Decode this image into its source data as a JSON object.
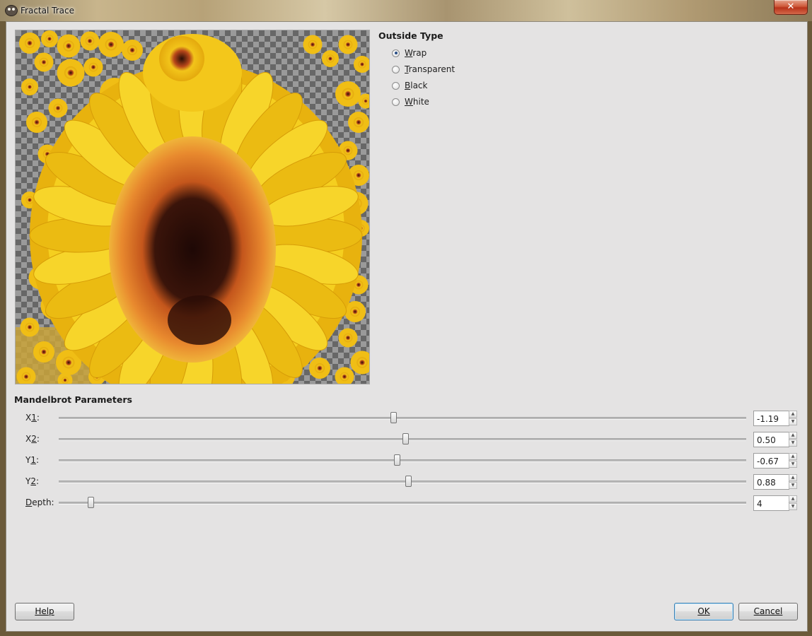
{
  "window": {
    "title": "Fractal Trace",
    "close_label": "✕"
  },
  "outside_type": {
    "title": "Outside Type",
    "options": [
      {
        "label": "Wrap",
        "checked": true
      },
      {
        "label": "Transparent",
        "checked": false
      },
      {
        "label": "Black",
        "checked": false
      },
      {
        "label": "White",
        "checked": false
      }
    ]
  },
  "mandelbrot": {
    "title": "Mandelbrot Parameters",
    "params": [
      {
        "label": "X1:",
        "value": "-1.19",
        "min": -50,
        "max": 50,
        "numeric": -1.19
      },
      {
        "label": "X2:",
        "value": "0.50",
        "min": -50,
        "max": 50,
        "numeric": 0.5
      },
      {
        "label": "Y1:",
        "value": "-0.67",
        "min": -50,
        "max": 50,
        "numeric": -0.67
      },
      {
        "label": "Y2:",
        "value": "0.88",
        "min": -50,
        "max": 50,
        "numeric": 0.88
      },
      {
        "label": "Depth:",
        "value": "4",
        "min": 1,
        "max": 65,
        "numeric": 4
      }
    ]
  },
  "buttons": {
    "help": "Help",
    "ok": "OK",
    "cancel": "Cancel"
  },
  "colors": {
    "petal": "#f2c416",
    "petal_dark": "#d99a06",
    "center_orange": "#e0782a",
    "center_dark": "#2a0f08",
    "accent_default": "#3c7fb1"
  },
  "icons": {
    "app": "gimp-icon",
    "spin_up": "triangle-up-icon",
    "spin_down": "triangle-down-icon"
  }
}
